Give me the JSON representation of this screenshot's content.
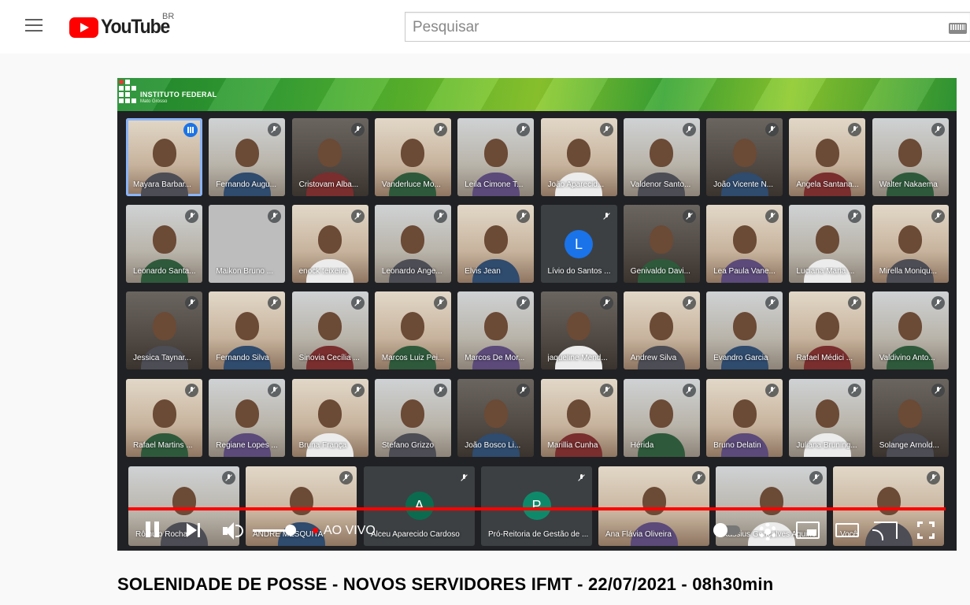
{
  "masthead": {
    "logo_text": "YouTube",
    "country_code": "BR",
    "search_placeholder": "Pesquisar",
    "icons": [
      "menu-icon",
      "youtube-logo",
      "keyboard-icon"
    ]
  },
  "video": {
    "banner": {
      "org_name": "INSTITUTO FEDERAL",
      "org_sub": "Mato Grosso",
      "color": "#3aa635"
    },
    "participants_rows": [
      [
        "Mayara Barbar...",
        "Fernando Augu...",
        "Cristovam Alba...",
        "Vanderluce Mo...",
        "Leila Cimone T...",
        "João Aparecid...",
        "Valdenor Santo...",
        "João Vicente N...",
        "Angela Santana...",
        "Walter Nakaema"
      ],
      [
        "Leonardo Santa...",
        "Maikon Bruno ...",
        "enock teixeira",
        "Leonardo Ânge...",
        "Elvis Jean",
        "Lívio do Santos ...",
        "Genivaldo Davi...",
        "Lea Paula Vane...",
        "Luciana Maria ...",
        "Mirella Moniqu..."
      ],
      [
        "Jessica Taynar...",
        "Fernando Silva",
        "Sinovia Cecília ...",
        "Marcos Luiz Pei...",
        "Marcos De Mor...",
        "jaqueline Mend...",
        "Andrew Silva",
        "Evandro Garcia",
        "Rafael Médici ...",
        "Valdivino Anto..."
      ],
      [
        "Rafael Martins ...",
        "Regiane Lopes ...",
        "Bruna França",
        "Stefano Grizzo",
        "João Bosco Li...",
        "Marillia Cunha",
        "Hérida",
        "Bruno Delatin",
        "Juliana Bruning...",
        "Solange Arnold..."
      ],
      [
        "Rômulo Rocha",
        "ANDRÉ MESQUITA",
        "Alceu Aparecido Cardoso",
        "Pró-Reitoria de Gestão de ...",
        "Ana Flávia Oliveira",
        "Kassius Gonçalves Aquino",
        "Você"
      ]
    ],
    "avatar_letters": {
      "livio": "L",
      "alceu": "A",
      "proreitoria": "P"
    },
    "avatar_colors": {
      "livio": "#1a73e8",
      "alceu": "#0b6b4f",
      "proreitoria": "#0e8a6a"
    },
    "active_speaker": "Mayara Barbar...",
    "controls": {
      "live_label": "AO VIVO",
      "progress_color": "#ff0000",
      "icons": [
        "pause-icon",
        "next-icon",
        "volume-icon",
        "live-dot",
        "autoplay-toggle",
        "gear-icon",
        "miniplayer-icon",
        "theater-icon",
        "cast-icon",
        "fullscreen-icon"
      ]
    }
  },
  "title": "SOLENIDADE DE POSSE - NOVOS SERVIDORES IFMT - 22/07/2021 - 08h30min"
}
